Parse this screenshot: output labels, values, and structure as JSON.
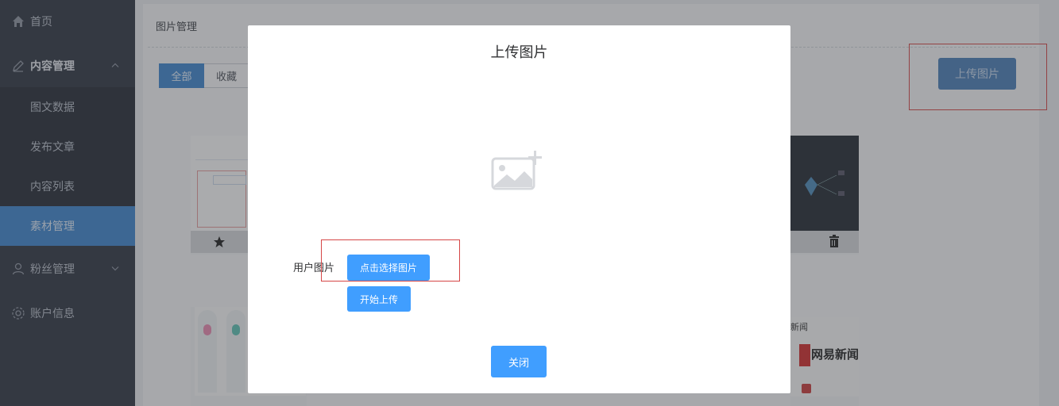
{
  "sidebar": {
    "items": [
      {
        "label": "首页",
        "icon": "home-icon"
      },
      {
        "label": "内容管理",
        "icon": "edit-icon"
      },
      {
        "label": "图文数据"
      },
      {
        "label": "发布文章"
      },
      {
        "label": "内容列表"
      },
      {
        "label": "素材管理"
      },
      {
        "label": "粉丝管理",
        "icon": "user-icon"
      },
      {
        "label": "账户信息",
        "icon": "settings-icon"
      }
    ]
  },
  "main": {
    "title": "图片管理",
    "tabs": [
      {
        "label": "全部",
        "active": true
      },
      {
        "label": "收藏",
        "active": false
      }
    ],
    "upload_button": "上传图片",
    "thumb_texts": {
      "netease": "网易新闻",
      "news_label": "新闻"
    }
  },
  "modal": {
    "title": "上传图片",
    "field_label": "用户图片",
    "select_button": "点击选择图片",
    "start_button": "开始上传",
    "close_button": "关闭"
  },
  "colors": {
    "sidebar_bg": "#303643",
    "accent": "#409eff",
    "active_item": "#3f86ce",
    "highlight_box": "#d54545"
  }
}
